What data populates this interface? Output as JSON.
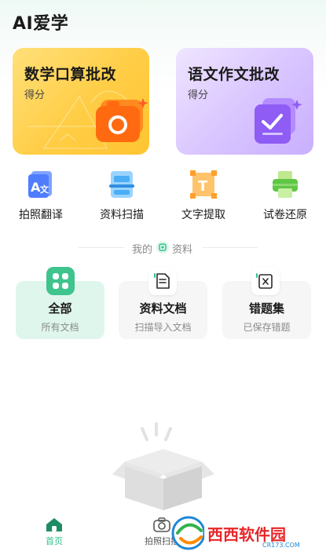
{
  "app": {
    "title": "AI爱学"
  },
  "feature_cards": [
    {
      "title": "数学口算批改",
      "subtitle": "得分"
    },
    {
      "title": "语文作文批改",
      "subtitle": "得分"
    }
  ],
  "tools": [
    {
      "label": "拍照翻译",
      "icon": "translate-icon"
    },
    {
      "label": "资料扫描",
      "icon": "scan-document-icon"
    },
    {
      "label": "文字提取",
      "icon": "text-extract-icon"
    },
    {
      "label": "试卷还原",
      "icon": "printer-icon"
    }
  ],
  "divider": {
    "left": "我的",
    "right": "资料"
  },
  "categories": [
    {
      "label": "全部",
      "sub": "所有文档",
      "active": true
    },
    {
      "label": "资料文档",
      "sub": "扫描导入文档",
      "active": false
    },
    {
      "label": "错题集",
      "sub": "已保存错题",
      "active": false
    }
  ],
  "nav": [
    {
      "label": "首页",
      "active": true
    },
    {
      "label": "拍照扫描",
      "active": false
    }
  ],
  "watermark": {
    "text": "西西软件园",
    "sub": "CR173.COM"
  },
  "colors": {
    "accent": "#2ec48a",
    "math_card": "#ffcd45",
    "chinese_card": "#d8c4ff",
    "active_category": "#dff6ec"
  }
}
